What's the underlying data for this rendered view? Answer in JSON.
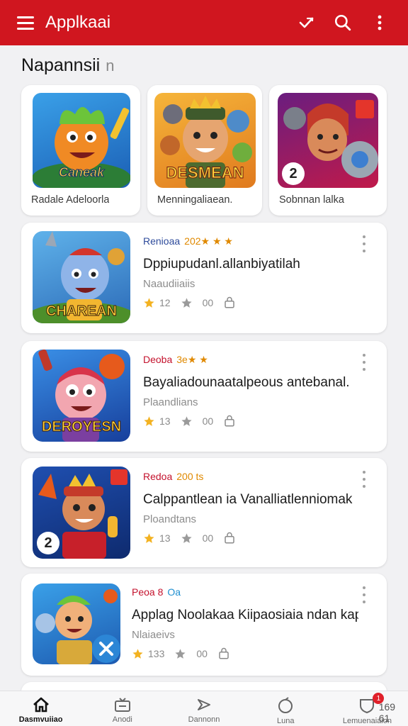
{
  "appbar": {
    "title": "Applkaai",
    "actions": [
      "pen-icon",
      "search-icon",
      "overflow-icon"
    ],
    "color": "#d0161f"
  },
  "section": {
    "title": "Napannsii",
    "suffix": "n"
  },
  "featured": [
    {
      "label": "Radale Adeloorla",
      "art": "Caneak"
    },
    {
      "label": "Menningaliaean.",
      "art": "DESMEAN"
    },
    {
      "label": "Sobnnan lalka",
      "art": "2"
    }
  ],
  "games": [
    {
      "publisher": "Renioaa",
      "extra": "202★ ★ ★",
      "title": "Dppiupudanl.allanbiyatilah",
      "subtitle": "Naaudiiaiis",
      "rating": "12",
      "downloads": "00",
      "art": "CHAREAN"
    },
    {
      "publisher": "Deoba",
      "extra": "3e★ ★",
      "title": "Bayaliadounaatalpeous antebanal.",
      "subtitle": "Plaandlians",
      "rating": "13",
      "downloads": "00",
      "art": "DEROYESN"
    },
    {
      "publisher": "Redoa",
      "extra": "200 ts",
      "title": "Calppantlean ia Vanalliatlenniomak",
      "subtitle": "Ploandtans",
      "rating": "13",
      "downloads": "00",
      "art": "2"
    },
    {
      "publisher": "Peoa 8",
      "extra": "Oa",
      "title": "Applag Noolakaa Kiipaosiaia ndan kapn",
      "subtitle": "Nlaiaeivs",
      "rating": "133",
      "downloads": "00",
      "art": ""
    }
  ],
  "bottom_nav": [
    {
      "label": "Dasmvuiiao",
      "icon": "home-icon",
      "active": true
    },
    {
      "label": "Anodi",
      "icon": "news-icon",
      "active": false
    },
    {
      "label": "Dannonn",
      "icon": "arrow-icon",
      "active": false
    },
    {
      "label": "Luna",
      "icon": "orb-icon",
      "active": false
    },
    {
      "label": "Lemuenaiaion",
      "icon": "shield-icon",
      "active": false,
      "badge": "1",
      "count": "169 61"
    }
  ]
}
